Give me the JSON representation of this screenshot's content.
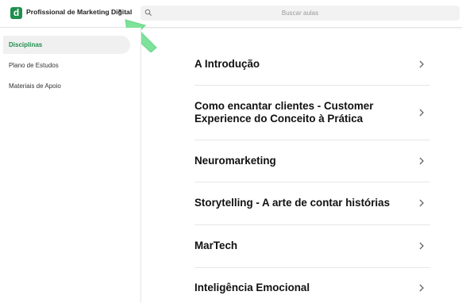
{
  "header": {
    "logo_letter": "d",
    "course_title": "Profissional de Marketing Digital",
    "search_placeholder": "Buscar aulas"
  },
  "sidebar": {
    "items": [
      {
        "label": "Disciplinas",
        "active": true
      },
      {
        "label": "Plano de Estudos",
        "active": false
      },
      {
        "label": "Materiais de Apoio",
        "active": false
      }
    ]
  },
  "disciplines": [
    {
      "title": "A Introdução"
    },
    {
      "title": "Como encantar clientes - Customer Experience do Conceito à Prática"
    },
    {
      "title": "Neuromarketing"
    },
    {
      "title": "Storytelling - A arte de contar histórias"
    },
    {
      "title": "MarTech"
    },
    {
      "title": "Inteligência Emocional"
    }
  ],
  "colors": {
    "brand_green": "#1e8f4e",
    "annotation_arrow": "#7ee29a"
  }
}
